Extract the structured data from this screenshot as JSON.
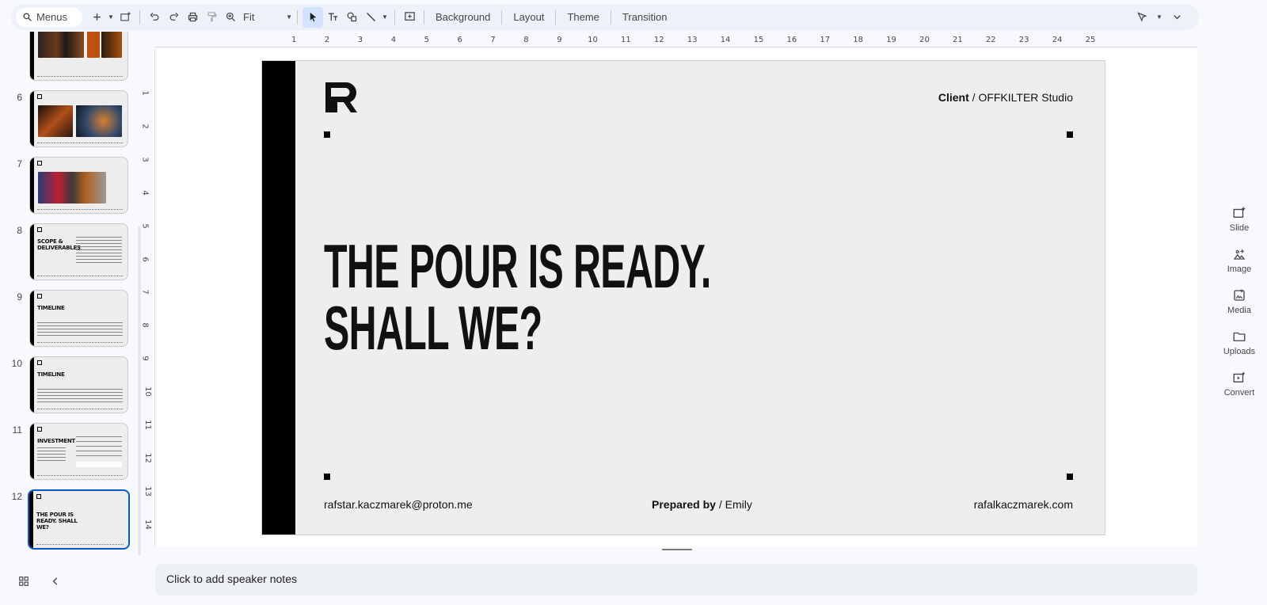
{
  "toolbar": {
    "search_label": "Menus",
    "zoom_value": "Fit",
    "background_label": "Background",
    "layout_label": "Layout",
    "theme_label": "Theme",
    "transition_label": "Transition"
  },
  "ruler": {
    "horizontal": [
      "1",
      "2",
      "3",
      "4",
      "5",
      "6",
      "7",
      "8",
      "9",
      "10",
      "11",
      "12",
      "13",
      "14",
      "15",
      "16",
      "17",
      "18",
      "19",
      "20",
      "21",
      "22",
      "23",
      "24",
      "25"
    ],
    "vertical": [
      "1",
      "2",
      "3",
      "4",
      "5",
      "6",
      "7",
      "8",
      "9",
      "10",
      "11",
      "12",
      "13",
      "14"
    ]
  },
  "filmstrip": {
    "slides": [
      {
        "number": "",
        "title": "",
        "type": "photos-partial"
      },
      {
        "number": "6",
        "title": "",
        "type": "photos"
      },
      {
        "number": "7",
        "title": "",
        "type": "photo-wide"
      },
      {
        "number": "8",
        "title": "SCOPE & DELIVERABLES",
        "type": "text"
      },
      {
        "number": "9",
        "title": "TIMELINE",
        "type": "text"
      },
      {
        "number": "10",
        "title": "TIMELINE",
        "type": "text"
      },
      {
        "number": "11",
        "title": "INVESTMENT",
        "type": "text"
      },
      {
        "number": "12",
        "title": "THE POUR IS READY. SHALL WE?",
        "type": "text",
        "selected": true
      }
    ]
  },
  "slide": {
    "client_label": "Client",
    "client_sep": "/",
    "client_name": "OFFKILTER Studio",
    "headline_line1": "THE POUR IS READY.",
    "headline_line2": "SHALL WE?",
    "email": "rafstar.kaczmarek@proton.me",
    "prepared_label": "Prepared by",
    "prepared_sep": "/",
    "prepared_name": "Emily",
    "website": "rafalkaczmarek.com"
  },
  "notes": {
    "placeholder": "Click to add speaker notes"
  },
  "right_panel": {
    "items": [
      {
        "label": "Slide",
        "icon": "add-slide-icon"
      },
      {
        "label": "Image",
        "icon": "image-sparkle-icon"
      },
      {
        "label": "Media",
        "icon": "media-icon"
      },
      {
        "label": "Uploads",
        "icon": "folder-icon"
      },
      {
        "label": "Convert",
        "icon": "convert-icon"
      }
    ]
  },
  "colors": {
    "accent": "#0b57d0",
    "toolbar_bg": "#edf2fa",
    "slide_bg": "#eeeeee",
    "slide_bar": "#000000"
  }
}
